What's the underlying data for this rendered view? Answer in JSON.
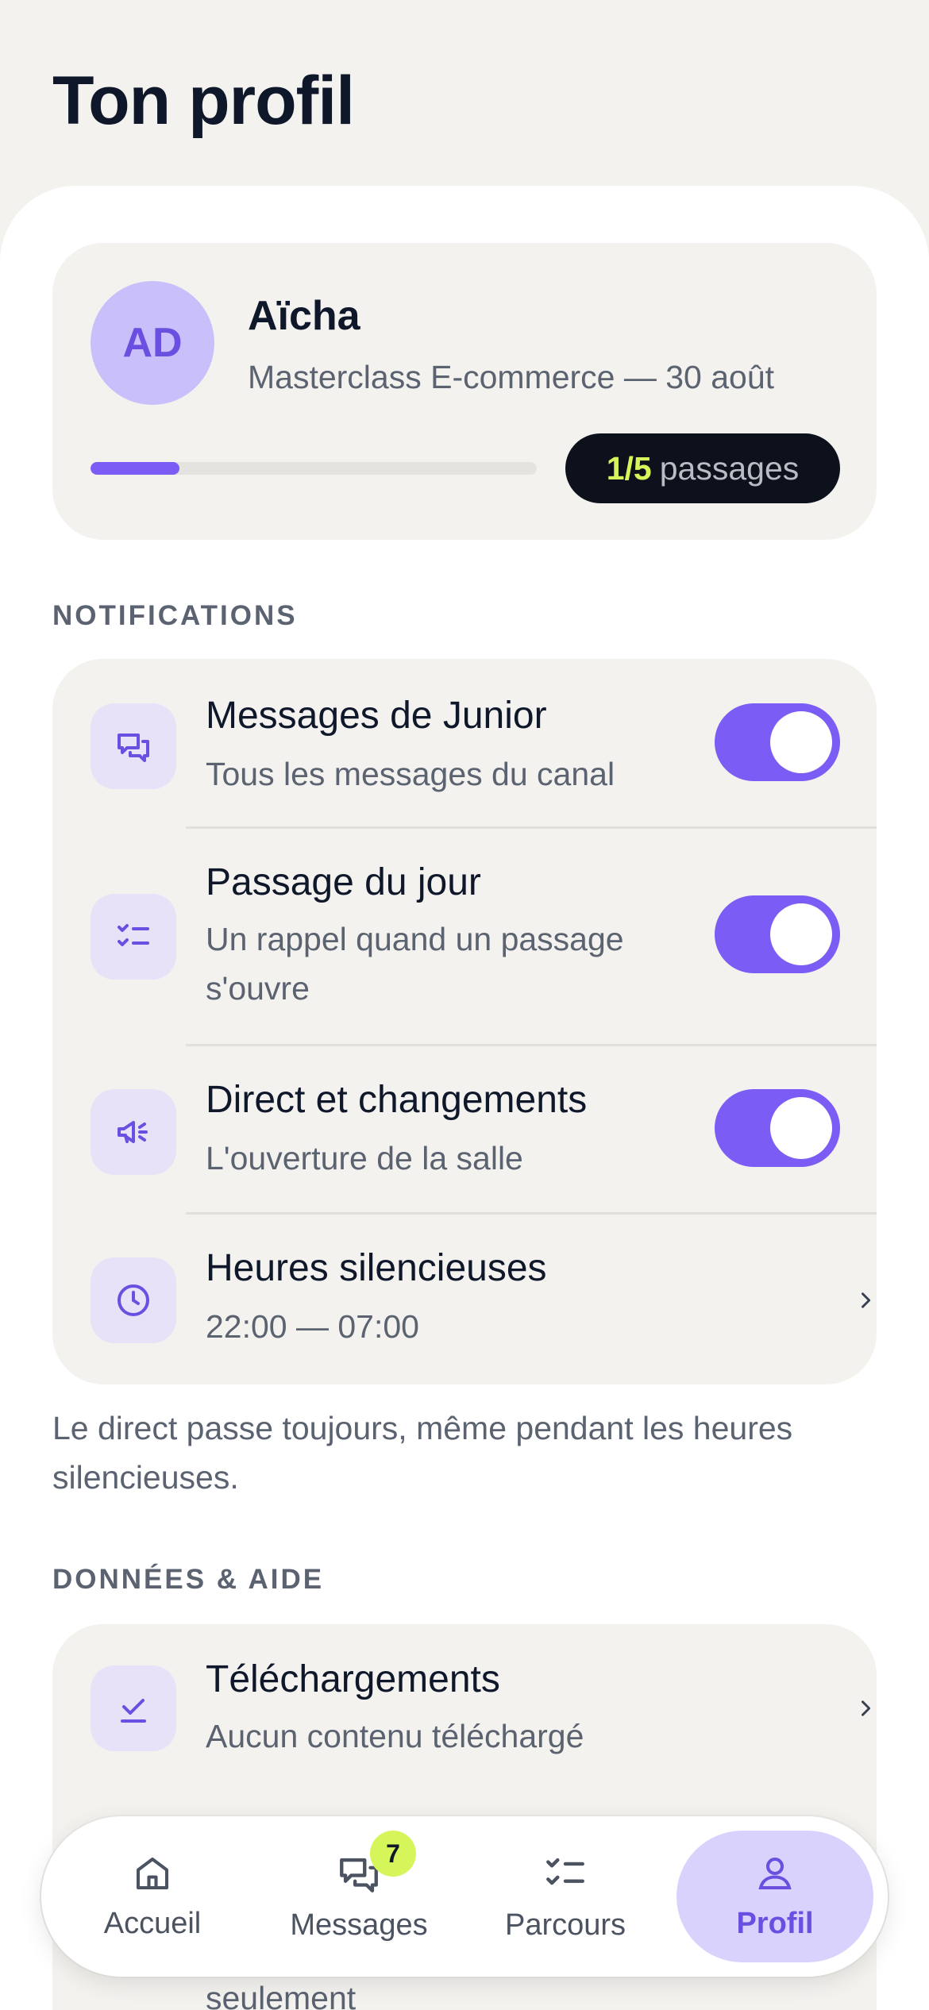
{
  "page_title": "Ton profil",
  "profile": {
    "initials": "AD",
    "name": "Aïcha",
    "subtitle": "Masterclass E-commerce — 30 août",
    "progress_fraction": 0.2,
    "passages_count": "1/5",
    "passages_label": "passages"
  },
  "notifications": {
    "section_label": "NOTIFICATIONS",
    "items": [
      {
        "title": "Messages de Junior",
        "subtitle": "Tous les messages du canal",
        "icon": "chat-icon",
        "enabled": true
      },
      {
        "title": "Passage du jour",
        "subtitle": "Un rappel quand un passage s'ouvre",
        "icon": "checklist-icon",
        "enabled": true
      },
      {
        "title": "Direct et changements",
        "subtitle": "L'ouverture de la salle",
        "icon": "megaphone-icon",
        "enabled": true
      },
      {
        "title": "Heures silencieuses",
        "subtitle": "22:00 — 07:00",
        "icon": "clock-icon"
      }
    ],
    "note": "Le direct passe toujours, même pendant les heures silencieuses."
  },
  "data_help": {
    "section_label": "DONNÉES & AIDE",
    "items": [
      {
        "title": "Téléchargements",
        "subtitle": "Aucun contenu téléchargé",
        "icon": "download-check-icon"
      }
    ],
    "peek_text": "seulement"
  },
  "bottom_nav": {
    "items": [
      {
        "label": "Accueil",
        "icon": "home-icon"
      },
      {
        "label": "Messages",
        "icon": "messages-icon",
        "badge": "7"
      },
      {
        "label": "Parcours",
        "icon": "checklist-icon"
      },
      {
        "label": "Profil",
        "icon": "user-icon",
        "active": true
      }
    ]
  },
  "colors": {
    "accent": "#7b5cf5",
    "lime": "#d6f55a",
    "background": "#f3f2ef"
  }
}
